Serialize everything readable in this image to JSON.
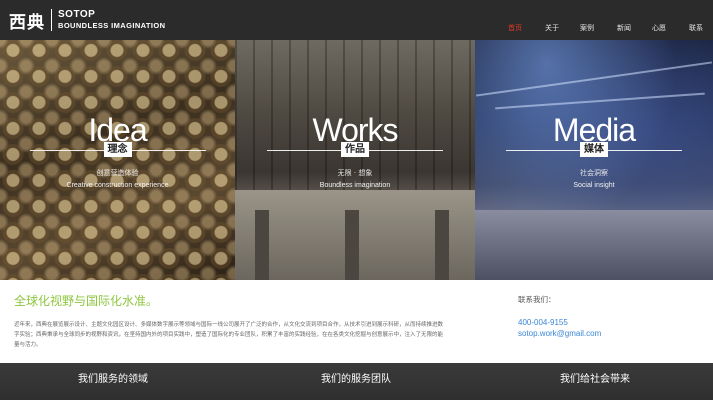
{
  "header": {
    "logo_cn": "西典",
    "logo_en_1": "SOTOP",
    "logo_en_2": "BOUNDLESS IMAGINATION",
    "nav": [
      "首页",
      "关于",
      "案例",
      "新闻",
      "心愿",
      "联系"
    ],
    "active_index": 0,
    "active_color": "#e5392a"
  },
  "panels": [
    {
      "title_en": "Idea",
      "title_cn": "理念",
      "sub_cn": "创意营造体验",
      "sub_en": "Creative construction experience"
    },
    {
      "title_en": "Works",
      "title_cn": "作品",
      "sub_cn": "无限 · 想象",
      "sub_en": "Boundless imagination"
    },
    {
      "title_en": "Media",
      "title_cn": "媒体",
      "sub_cn": "社会洞察",
      "sub_en": "Social insight"
    }
  ],
  "about": {
    "slogan": "全球化视野与国际化水准。",
    "intro": "近年来，西典在展览展示设计、主题文化园区设计、多媒体数字展示等领域与国际一线公司展开了广泛的合作，从文化交流到项目合作，从技术引进到展示科研，从而持续推进数字实验；西典秉承与全球同步的视野和资讯，在坚持国内外的项目实践中，塑造了国际化的专业团队，积累了丰富的实践经验，在在各类文化挖掘与创意展示中，注入了无限的能量与活力。",
    "contact_title": "联系我们：",
    "phone": "400-004-9155",
    "email": "sotop.work@gmail.com",
    "accent_color": "#8dc63f",
    "link_color": "#3a86d6"
  },
  "footer": {
    "items": [
      "我们服务的领域",
      "我们的服务团队",
      "我们给社会带来"
    ]
  }
}
